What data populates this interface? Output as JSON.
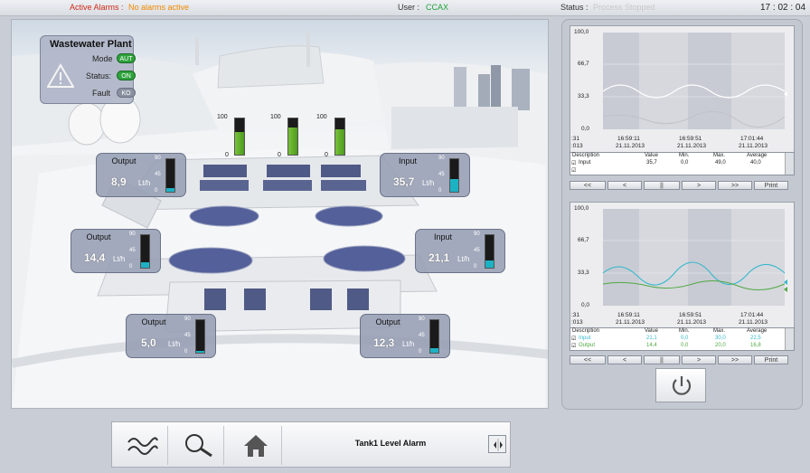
{
  "header": {
    "alarm_label": "Active Alarms :",
    "alarm_value": "No alarms active",
    "user_label": "User :",
    "user_value": "CCAX",
    "status_label": "Status :",
    "status_value": "Process Stopped",
    "clock": "17 : 02 : 04"
  },
  "plant": {
    "title": "Wastewater Plant",
    "mode_label": "Mode",
    "mode_value": "AUT",
    "status_label": "Status:",
    "status_value": "ON",
    "fault_label": "Fault",
    "fault_value": "KO"
  },
  "tanks": {
    "scale_top": "100",
    "scale_bottom": "0",
    "levels": [
      0.62,
      0.75,
      0.7
    ]
  },
  "flows": [
    {
      "title": "Output",
      "value": "8,9",
      "unit": "Lt/h",
      "max": "90",
      "mid": "45",
      "min": "0",
      "level": 0.1
    },
    {
      "title": "Input",
      "value": "35,7",
      "unit": "Lt/h",
      "max": "90",
      "mid": "45",
      "min": "0",
      "level": 0.4
    },
    {
      "title": "Output",
      "value": "14,4",
      "unit": "Lt/h",
      "max": "90",
      "mid": "45",
      "min": "0",
      "level": 0.16
    },
    {
      "title": "Input",
      "value": "21,1",
      "unit": "Lt/h",
      "max": "90",
      "mid": "45",
      "min": "0",
      "level": 0.23
    },
    {
      "title": "Output",
      "value": "5,0",
      "unit": "Lt/h",
      "max": "90",
      "mid": "45",
      "min": "0",
      "level": 0.06
    },
    {
      "title": "Output",
      "value": "12,3",
      "unit": "Lt/h",
      "max": "90",
      "mid": "45",
      "min": "0",
      "level": 0.14
    }
  ],
  "trend1": {
    "y_labels": [
      "100,0",
      "66,7",
      "33,3",
      "0,0"
    ],
    "x_labels": [
      ":31",
      "16:59:11",
      "16:59:51",
      "17:01:44"
    ],
    "x_dates": [
      ":013",
      "21.11.2013",
      "21.11.2013",
      "21.11.2013"
    ],
    "table_headers": [
      "Description",
      "Value",
      "Min.",
      "Max.",
      "Average"
    ],
    "rows": [
      {
        "desc": "Input",
        "value": "35,7",
        "min": "0,0",
        "max": "49,0",
        "avg": "40,0"
      },
      {
        "desc": "",
        "value": "",
        "min": "",
        "max": "",
        "avg": ""
      }
    ],
    "buttons": [
      "<<",
      "<",
      "||",
      ">",
      ">>",
      "Print"
    ]
  },
  "trend2": {
    "y_labels": [
      "100,0",
      "66,7",
      "33,3",
      "0,0"
    ],
    "x_labels": [
      ":31",
      "16:59:11",
      "16:59:51",
      "17:01:44"
    ],
    "x_dates": [
      ":013",
      "21.11.2013",
      "21.11.2013",
      "21.11.2013"
    ],
    "table_headers": [
      "Description",
      "Value",
      "Min.",
      "Max.",
      "Average"
    ],
    "rows": [
      {
        "desc": "Input",
        "value": "21,1",
        "min": "0,0",
        "max": "30,0",
        "avg": "22,5"
      },
      {
        "desc": "Output",
        "value": "14,4",
        "min": "0,0",
        "max": "20,0",
        "avg": "16,8"
      }
    ],
    "buttons": [
      "<<",
      "<",
      "||",
      ">",
      ">>",
      "Print"
    ]
  },
  "bottom": {
    "alarm_text": "Tank1 Level Alarm",
    "icons": [
      "trend-icon",
      "search-icon",
      "home-icon",
      "power-icon"
    ]
  },
  "colors": {
    "alarm": "#d02a18",
    "alarm_value": "#f08a00",
    "user": "#1fa23a",
    "water": "#1cb2c4",
    "tank": "#5fae27",
    "panel": "#9aa2b8"
  }
}
